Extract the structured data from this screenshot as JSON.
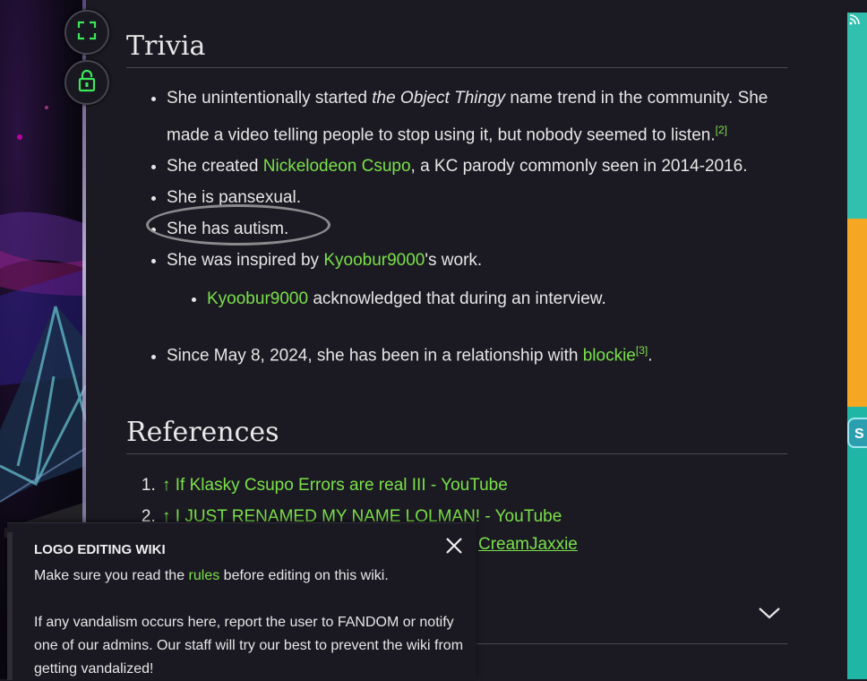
{
  "trivia_heading": "Trivia",
  "trivia": {
    "item1_a": "She unintentionally started ",
    "item1_em": "the Object Thingy",
    "item1_b": " name trend in the community. She made a video telling people to stop using it, but nobody seemed to listen.",
    "item1_ref": "[2]",
    "item2_a": "She created ",
    "item2_link": "Nickelodeon Csupo",
    "item2_b": ", a KC parody commonly seen in 2014-2016.",
    "item3": "She is pansexual.",
    "item4": "She has autism.",
    "item5_a": "She was inspired by ",
    "item5_link": "Kyoobur9000",
    "item5_b": "'s work.",
    "sub1_link": "Kyoobur9000",
    "sub1_b": " acknowledged that during an interview.",
    "item6_a": "Since May 8, 2024, she has been in a relationship with ",
    "item6_link": "blockie",
    "item6_ref": "[3]",
    "item6_b": "."
  },
  "references_heading": "References",
  "references": [
    {
      "arrow": "↑",
      "text": "If Klasky Csupo Errors are real III - YouTube"
    },
    {
      "arrow": "↑",
      "text": "I JUST RENAMED MY NAME LOLMAN! - YouTube"
    }
  ],
  "partial_ref_text": "CreamJaxxie",
  "notice": {
    "title": "LOGO EDITING WIKI",
    "line1_a": "Make sure you read the ",
    "line1_link": "rules",
    "line1_b": " before editing on this wiki.",
    "para2": "If any vandalism occurs here, report the user to FANDOM or notify one of our admins. Our staff will try our best to prevent the wiki from getting vandalized!"
  },
  "right_badge": "S",
  "colors": {
    "link": "#7ae04a",
    "background": "#1b1a22",
    "icon_green": "#3ee65a",
    "accent_orange": "#f5a623",
    "accent_teal": "#1fb6a6"
  },
  "icons": [
    "fullscreen-icon",
    "lock-icon",
    "close-icon",
    "chevron-down-icon",
    "rss-icon"
  ]
}
